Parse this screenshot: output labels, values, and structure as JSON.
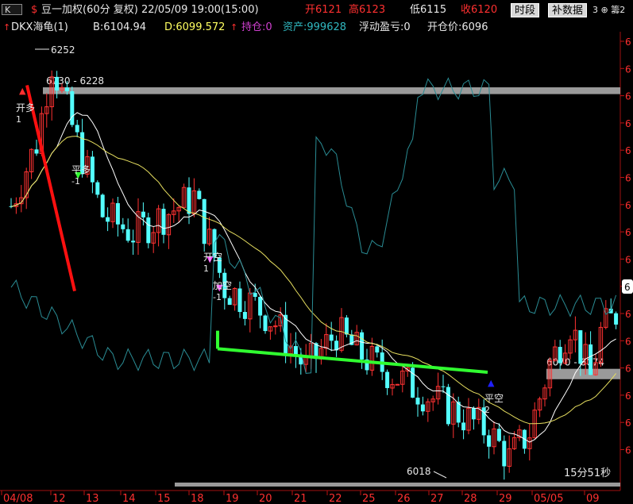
{
  "header": {
    "k_label": "K",
    "s_marker": "$",
    "title": "豆一加权(60分 复权) 22/05/09 19:00(15:00)",
    "open": "开6121",
    "high": "高6123",
    "low": "低6115",
    "close": "收6120",
    "btn_period": "时段",
    "btn_supplement": "补数据",
    "right_icons": "3 ⊕ 籌2",
    "colors": {
      "title": "#e8e8e8",
      "open": "#ff3030",
      "high": "#ff3030",
      "low": "#e8e8e8",
      "close": "#ff3030"
    }
  },
  "indicator": {
    "arrow": "↑",
    "name": "DKX海龟(1)",
    "b": "B:6104.94",
    "d": "D:6099.572",
    "arrow2": "↑",
    "position": "持仓:0",
    "assets": "资产:999628",
    "floating_pl": "浮动盈亏:0",
    "open_price": "开仓价:6096",
    "colors": {
      "name": "#e8e8e8",
      "b": "#e8e8e8",
      "d": "#ffff60",
      "position": "#d040d0",
      "assets": "#30b8c0",
      "floating_pl": "#e8e8e8",
      "open_price": "#e8e8e8"
    }
  },
  "chart_data": {
    "type": "candlestick",
    "symbol": "豆一加权",
    "period": "60分",
    "price_range_visible": [
      6018,
      6252
    ],
    "x_tick_labels": [
      "04/08",
      "12",
      "13",
      "14",
      "15",
      "18",
      "19",
      "20",
      "21",
      "22",
      "25",
      "26",
      "27",
      "28",
      "29",
      "05/05",
      "09"
    ],
    "support_resistance": [
      {
        "label": "6230 - 6228",
        "high": 6230,
        "low": 6228
      },
      {
        "label": "6070 - 6074",
        "high": 6074,
        "low": 6070
      }
    ],
    "price_labels": [
      "6252",
      "6018",
      "6"
    ],
    "signals": [
      {
        "text": "开多",
        "sub": "1",
        "type": "open-long"
      },
      {
        "text": "平多",
        "sub": "-1",
        "type": "close-long"
      },
      {
        "text": "开空",
        "sub": "1",
        "type": "open-short"
      },
      {
        "text": "加空",
        "sub": "-1",
        "type": "add-short"
      },
      {
        "text": "平空",
        "sub": "2",
        "type": "close-short"
      }
    ],
    "countdown": "15分51秒"
  }
}
